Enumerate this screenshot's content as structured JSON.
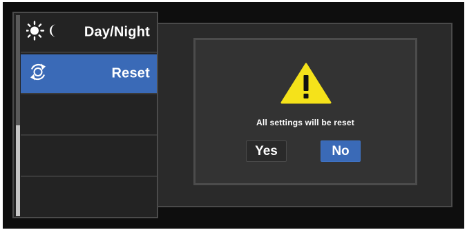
{
  "menu": {
    "items": [
      {
        "label": "Day/Night",
        "icon": "sun-moon-icon"
      },
      {
        "label": "Reset",
        "icon": "reset-icon",
        "selected": true
      },
      {
        "label": ""
      },
      {
        "label": ""
      },
      {
        "label": ""
      }
    ]
  },
  "dialog": {
    "icon": "warning-icon",
    "message": "All settings will be reset",
    "yes_label": "Yes",
    "no_label": "No"
  },
  "colors": {
    "selection_blue": "#3a6ab7",
    "warning_yellow": "#f5e21a",
    "background": "#0e0e0e"
  }
}
